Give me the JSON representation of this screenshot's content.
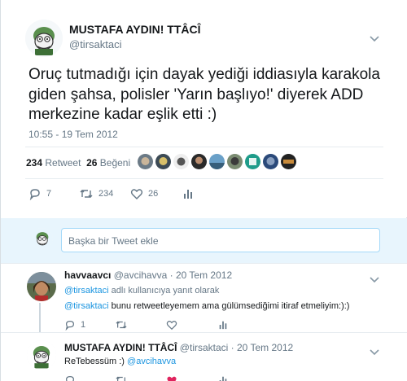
{
  "tweet": {
    "name": "MUSTAFA AYDIN! TTÂCÎ",
    "handle": "@tirsaktaci",
    "text": "Oruç tutmadığı için dayak yediği iddiasıyla karakola giden şahsa, polisler 'Yarın başlıyo!' diyerek ADD merkezine kadar eşlik etti :)",
    "time": "10:55 - 19 Tem 2012",
    "retweet_count": "234",
    "retweet_label": "Retweet",
    "like_count": "26",
    "like_label": "Beğeni",
    "actions": {
      "reply": "7",
      "retweet": "234",
      "like": "26"
    }
  },
  "reply_box": {
    "placeholder": "Başka bir Tweet ekle"
  },
  "replies": [
    {
      "name": "havvaavcı",
      "handle": "@avcihavva",
      "date": "· 20 Tem 2012",
      "reply_to_mention": "@tirsaktaci",
      "reply_to_suffix": " adlı kullanıcıya yanıt olarak",
      "mention": "@tirsaktaci",
      "text": " bunu retweetleyemem ama gülümsediğimi itiraf etmeliyim:):)",
      "reply_count": "1"
    },
    {
      "name": "MUSTAFA AYDIN! TTÂCÎ",
      "handle": "@tirsaktaci",
      "date": "· 20 Tem 2012",
      "text": "ReTebessüm :) ",
      "mention": "@avcihavva"
    }
  ],
  "colors": {
    "accent": "#1da1f2",
    "mention": "#1b95e0",
    "like": "#e0245e",
    "muted": "#657786"
  }
}
